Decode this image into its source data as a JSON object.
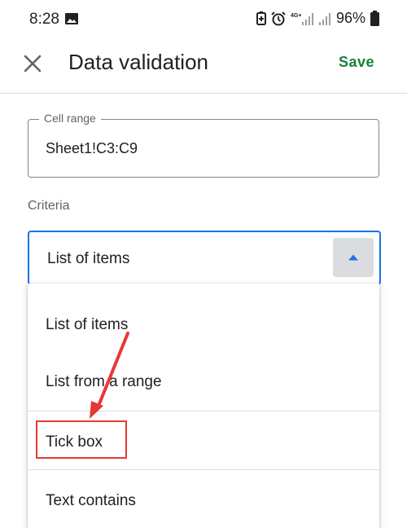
{
  "status_bar": {
    "time": "8:28",
    "network": "4G+",
    "battery": "96%"
  },
  "app_bar": {
    "title": "Data validation",
    "save_label": "Save"
  },
  "cell_range": {
    "label": "Cell range",
    "value": "Sheet1!C3:C9"
  },
  "criteria": {
    "label": "Criteria",
    "selected": "List of items",
    "options": [
      "List of items",
      "List from a range",
      "Tick box",
      "Text contains"
    ]
  },
  "colors": {
    "accent": "#1a73e8",
    "save": "#188038",
    "annotation": "#e53935"
  },
  "annotation": {
    "highlighted_option": "Tick box"
  }
}
